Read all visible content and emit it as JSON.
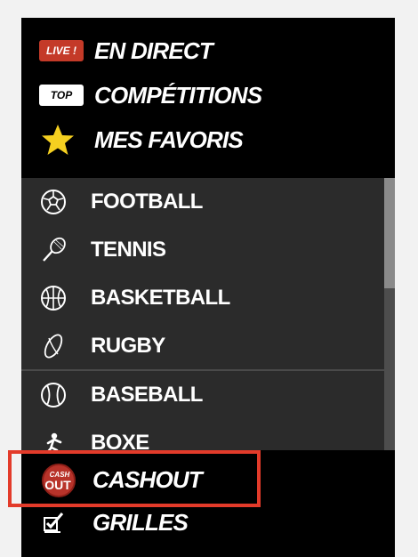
{
  "menu": {
    "live": {
      "badge": "LIVE !",
      "label": "EN DIRECT"
    },
    "top": {
      "badge": "TOP",
      "label": "COMPÉTITIONS"
    },
    "favorites": {
      "label": "MES FAVORIS",
      "icon": "star-icon"
    }
  },
  "sports": [
    {
      "label": "FOOTBALL",
      "icon": "soccer-ball-icon"
    },
    {
      "label": "TENNIS",
      "icon": "tennis-racket-icon"
    },
    {
      "label": "BASKETBALL",
      "icon": "basketball-icon"
    },
    {
      "label": "RUGBY",
      "icon": "rugby-ball-icon"
    },
    {
      "label": "BASEBALL",
      "icon": "baseball-icon"
    },
    {
      "label": "BOXE",
      "icon": "boxing-icon"
    }
  ],
  "bottom": {
    "cashout": {
      "label": "CASHOUT",
      "logo_text_top": "CASH",
      "logo_text_bottom": "OUT"
    },
    "grilles": {
      "label": "GRILLES",
      "icon": "checklist-icon"
    }
  },
  "colors": {
    "live_badge": "#c43a28",
    "highlight_border": "#e33b2a",
    "star": "#f5d020",
    "panel": "#000000",
    "sports_bg": "#2b2b2b"
  }
}
